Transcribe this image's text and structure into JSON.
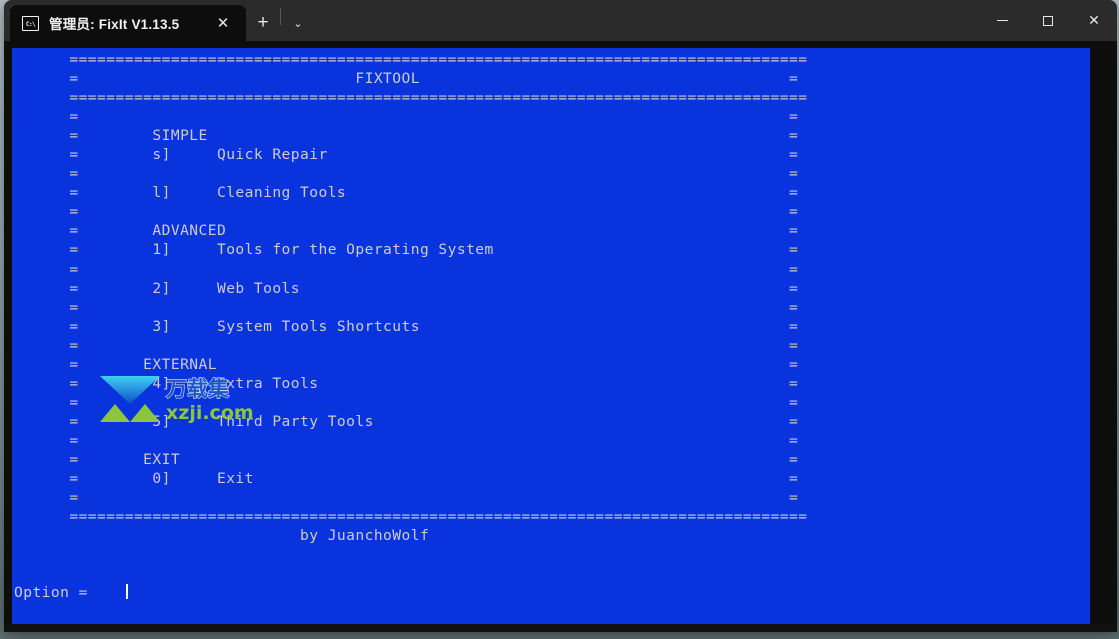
{
  "window": {
    "tab": {
      "icon": "console-icon",
      "title": "管理员: FixIt V1.13.5",
      "close_label": "✕"
    },
    "new_tab_label": "+",
    "tab_menu_label": "⌄",
    "controls": {
      "minimize_label": "—",
      "maximize_label": "□",
      "close_label": "✕"
    }
  },
  "terminal": {
    "background_color": "#0833dd",
    "text_color": "#ccccce",
    "app_title": "FIXTOOL",
    "author_line": "by JuanchoWolf",
    "prompt_label": "Option = ",
    "prompt_value": "",
    "border_char": "=",
    "sections": [
      {
        "heading": "SIMPLE",
        "items": [
          {
            "key": "s]",
            "label": "Quick Repair"
          },
          {
            "key": "l]",
            "label": "Cleaning Tools"
          }
        ]
      },
      {
        "heading": "ADVANCED",
        "items": [
          {
            "key": "1]",
            "label": "Tools for the Operating System"
          },
          {
            "key": "2]",
            "label": "Web Tools"
          },
          {
            "key": "3]",
            "label": "System Tools Shortcuts"
          }
        ]
      },
      {
        "heading": "EXTERNAL",
        "items": [
          {
            "key": "4]",
            "label": "Extra Tools"
          },
          {
            "key": "5]",
            "label": "Third Party Tools"
          }
        ]
      },
      {
        "heading": "EXIT",
        "items": [
          {
            "key": "0]",
            "label": "Exit"
          }
        ]
      }
    ],
    "screen_lines": [
      "      ================================================================================",
      "      =                              FIXTOOL                                        =",
      "      ================================================================================",
      "      =                                                                             =",
      "      =        SIMPLE                                                               =",
      "      =        s]     Quick Repair                                                  =",
      "      =                                                                             =",
      "      =        l]     Cleaning Tools                                                =",
      "      =                                                                             =",
      "      =        ADVANCED                                                             =",
      "      =        1]     Tools for the Operating System                                =",
      "      =                                                                             =",
      "      =        2]     Web Tools                                                     =",
      "      =                                                                             =",
      "      =        3]     System Tools Shortcuts                                        =",
      "      =                                                                             =",
      "      =       EXTERNAL                                                              =",
      "      =        4]     Extra Tools                                                   =",
      "      =                                                                             =",
      "      =        5]     Third Party Tools                                             =",
      "      =                                                                             =",
      "      =       EXIT                                                                  =",
      "      =        0]     Exit                                                          =",
      "      =                                                                             =",
      "      ================================================================================",
      "                               by JuanchoWolf",
      ""
    ]
  },
  "watermark": {
    "brand_cn": "万载集",
    "domain": "xzji.com",
    "logo_top_color": "#36c6ef",
    "logo_mid_color": "#1565d8",
    "logo_green_color": "#8cc63f",
    "domain_color": "#8cc63f"
  }
}
